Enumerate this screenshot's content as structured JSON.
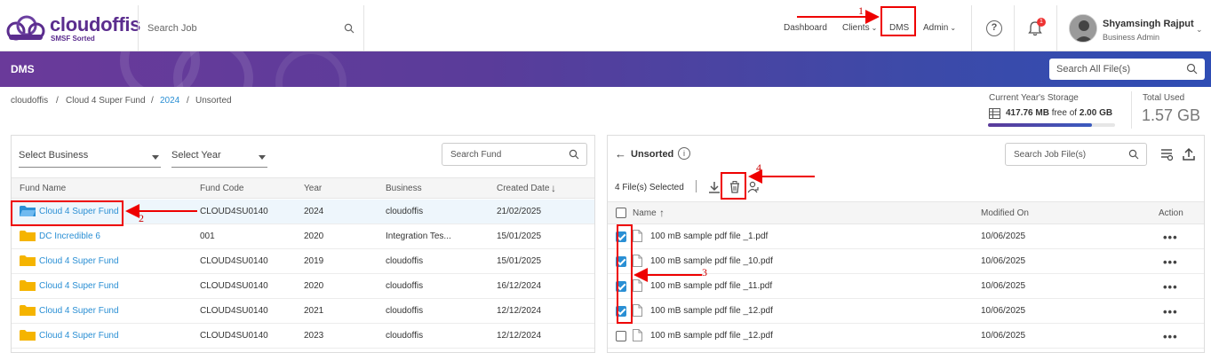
{
  "app": {
    "logo_text": "cloudoffis",
    "logo_sub": "SMSF Sorted",
    "search_placeholder": "Search Job",
    "nav": [
      "Dashboard",
      "Clients",
      "DMS",
      "Admin"
    ],
    "notification_count": "1",
    "user_name": "Shyamsingh Rajput",
    "user_role": "Business Admin"
  },
  "banner": {
    "title": "DMS",
    "search_placeholder": "Search All File(s)"
  },
  "breadcrumb": [
    "cloudoffis",
    "Cloud 4 Super Fund",
    "2024",
    "Unsorted"
  ],
  "storage": {
    "label": "Current Year's Storage",
    "used": "417.76 MB",
    "free_text": "free of",
    "total": "2.00 GB",
    "fill_fraction": 0.82,
    "total_used_label": "Total Used",
    "total_used_value": "1.57 GB"
  },
  "left_panel": {
    "select_business": "Select Business",
    "select_year": "Select Year",
    "search_placeholder": "Search Fund",
    "columns": [
      "Fund Name",
      "Fund Code",
      "Year",
      "Business",
      "Created Date"
    ],
    "rows": [
      {
        "name": "Cloud 4 Super Fund",
        "code": "CLOUD4SU0140",
        "year": "2024",
        "business": "cloudoffis",
        "created": "21/02/2025"
      },
      {
        "name": "DC Incredible 6",
        "code": "001",
        "year": "2020",
        "business": "Integration Tes...",
        "created": "15/01/2025"
      },
      {
        "name": "Cloud 4 Super Fund",
        "code": "CLOUD4SU0140",
        "year": "2019",
        "business": "cloudoffis",
        "created": "15/01/2025"
      },
      {
        "name": "Cloud 4 Super Fund",
        "code": "CLOUD4SU0140",
        "year": "2020",
        "business": "cloudoffis",
        "created": "16/12/2024"
      },
      {
        "name": "Cloud 4 Super Fund",
        "code": "CLOUD4SU0140",
        "year": "2021",
        "business": "cloudoffis",
        "created": "12/12/2024"
      },
      {
        "name": "Cloud 4 Super Fund",
        "code": "CLOUD4SU0140",
        "year": "2023",
        "business": "cloudoffis",
        "created": "12/12/2024"
      }
    ]
  },
  "right_panel": {
    "title": "Unsorted",
    "search_placeholder": "Search Job File(s)",
    "files_selected": "4 File(s) Selected",
    "columns": [
      "Name",
      "Modified On",
      "Action"
    ],
    "rows": [
      {
        "name": "100 mB sample pdf file _1.pdf",
        "modified": "10/06/2025",
        "checked": true,
        "action": "•••"
      },
      {
        "name": "100 mB sample pdf file _10.pdf",
        "modified": "10/06/2025",
        "checked": true,
        "action": "•••"
      },
      {
        "name": "100 mB sample pdf file _11.pdf",
        "modified": "10/06/2025",
        "checked": true,
        "action": "•••"
      },
      {
        "name": "100 mB sample pdf file _12.pdf",
        "modified": "10/06/2025",
        "checked": true,
        "action": "•••"
      },
      {
        "name": "100 mB sample pdf file _12.pdf",
        "modified": "10/06/2025",
        "checked": false,
        "action": "•••"
      }
    ]
  },
  "annotations": [
    "1",
    "2",
    "3",
    "4"
  ],
  "colors": {
    "accent": "#2a8fd4",
    "brand": "#5b2d8e",
    "annotation": "#e00000",
    "folder": "#f5b400"
  }
}
